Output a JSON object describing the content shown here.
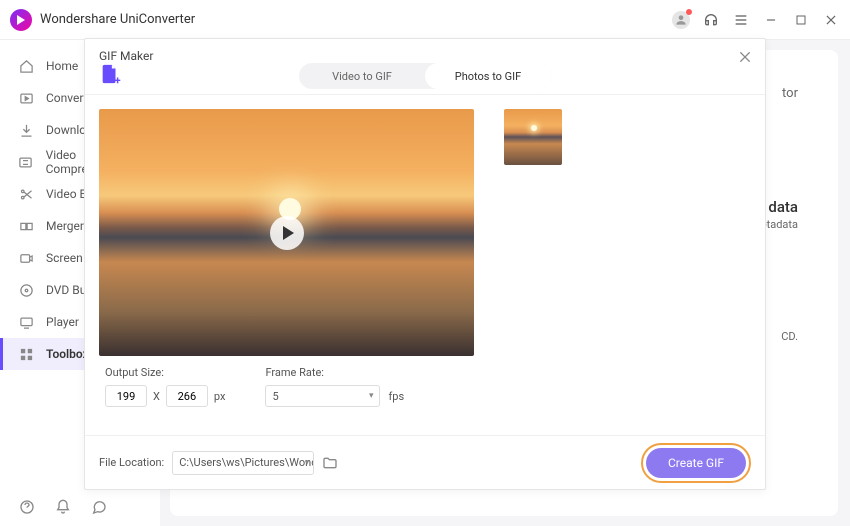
{
  "app": {
    "title": "Wondershare UniConverter"
  },
  "sidebar": {
    "items": [
      {
        "label": "Home"
      },
      {
        "label": "Converter"
      },
      {
        "label": "Downloader"
      },
      {
        "label": "Video Compressor"
      },
      {
        "label": "Video Editor"
      },
      {
        "label": "Merger"
      },
      {
        "label": "Screen Recorder"
      },
      {
        "label": "DVD Burner"
      },
      {
        "label": "Player"
      },
      {
        "label": "Toolbox"
      }
    ]
  },
  "bg_hints": {
    "a": "tor",
    "b": "data",
    "c": "etadata",
    "d": "CD."
  },
  "modal": {
    "title": "GIF Maker",
    "tabs": {
      "video": "Video to GIF",
      "photos": "Photos to GIF"
    },
    "output_size_label": "Output Size:",
    "width": "199",
    "height": "266",
    "times": "X",
    "px": "px",
    "frame_rate_label": "Frame Rate:",
    "frame_rate_value": "5",
    "fps": "fps",
    "file_location_label": "File Location:",
    "file_location_value": "C:\\Users\\ws\\Pictures\\Wonders",
    "create_label": "Create GIF"
  }
}
